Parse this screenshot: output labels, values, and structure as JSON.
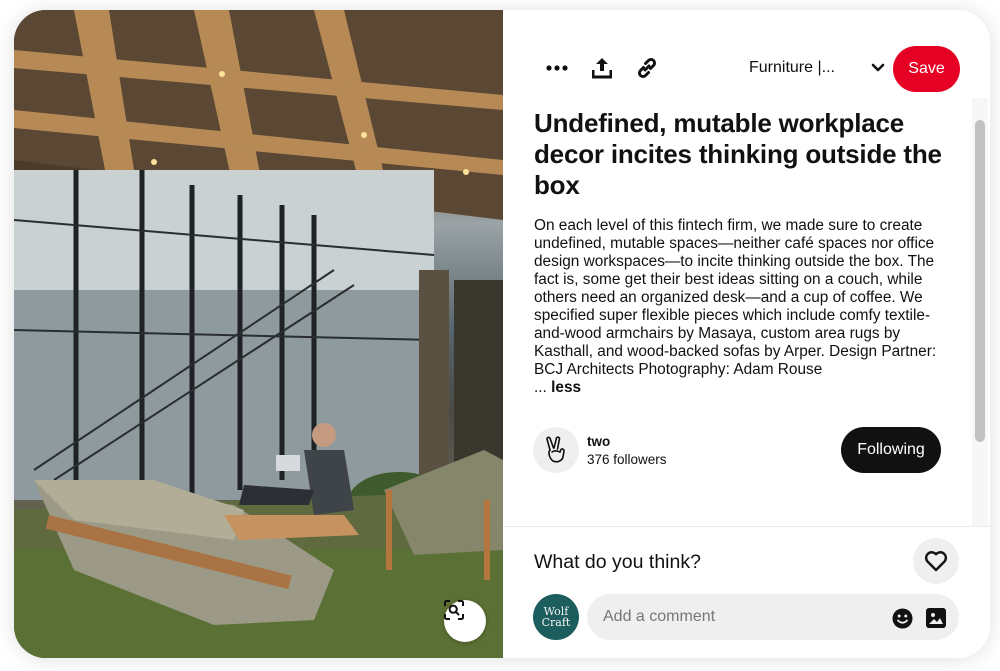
{
  "pin": {
    "title": "Undefined, mutable workplace decor incites thinking outside the box",
    "description": "On each level of this fintech firm, we made sure to create undefined, mutable spaces—neither café spaces nor office design workspaces—to incite thinking outside the box. The fact is, some get their best ideas sitting on a couch, while others need an organized desk—and a cup of coffee. We specified super flexible pieces which include comfy textile-and-wood armchairs by Masaya, custom area rugs by Kasthall, and wood-backed sofas by Arper. Design Partner: BCJ Architects Photography: Adam Rouse",
    "less_prefix": "...",
    "less_label": "less"
  },
  "toolbar": {
    "more_icon": "more-horizontal-icon",
    "share_icon": "share-upload-icon",
    "link_icon": "link-icon",
    "board_name": "Furniture |...",
    "board_chevron_icon": "chevron-down-icon",
    "save_label": "Save"
  },
  "creator": {
    "avatar_icon": "victory-hand-icon",
    "name": "two",
    "followers": "376 followers",
    "following_label": "Following"
  },
  "comments": {
    "prompt": "What do you think?",
    "react_icon": "heart-icon",
    "user_avatar_text_line1": "Wolf",
    "user_avatar_text_line2": "Craft",
    "placeholder": "Add a comment",
    "emoji_icon": "emoji-icon",
    "image_icon": "image-icon"
  },
  "image": {
    "lens_icon": "visual-search-icon"
  },
  "colors": {
    "save_bg": "#e60023",
    "following_bg": "#111111",
    "input_bg": "#efefef",
    "avatar_bg": "#1c5d5e"
  }
}
